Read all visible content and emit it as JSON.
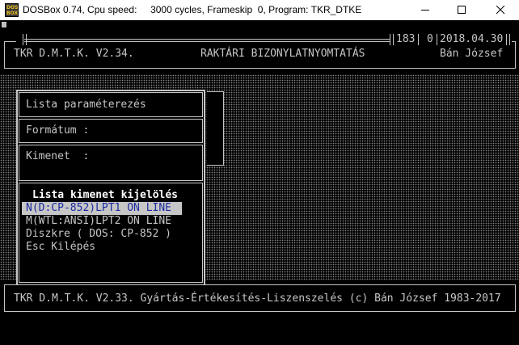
{
  "window": {
    "title": "DOSBox 0.74, Cpu speed:     3000 cycles, Frameskip  0, Program: TKR_DTKE",
    "icon_label": "DOS BOX",
    "icons": {
      "minimize": "minimize-icon",
      "maximize": "maximize-icon",
      "close": "close-icon"
    }
  },
  "header": {
    "counter1": "183",
    "counter2": "0",
    "date": "2018.04.30",
    "app_name": "TKR D.M.T.K. V2.34.",
    "module_title": "RAKTÁRI BIZONYLATNYOMTATÁS",
    "user": "Bán József"
  },
  "panel": {
    "param_title": "Lista paraméterezés",
    "format_label": "Formátum :",
    "output_label": "Kimenet  :",
    "menu_title": "Lista kimenet kijelölés",
    "options": [
      "N(D:CP-852)LPT1 ON LINE",
      "M(WTL:ANSI)LPT2 ON LINE",
      "Diszkre ( DOS: CP-852 )",
      "Esc Kilépés"
    ]
  },
  "footer": {
    "text": "TKR D.M.T.K. V2.33. Gyártás-Értékesítés-Liszenszelés (c) Bán József 1983-2017"
  },
  "colors": {
    "screen_bg": "#000000",
    "screen_fg": "#c6c6c6",
    "highlight_bg": "#c6c6c6",
    "highlight_fg": "#1a2aa0"
  }
}
